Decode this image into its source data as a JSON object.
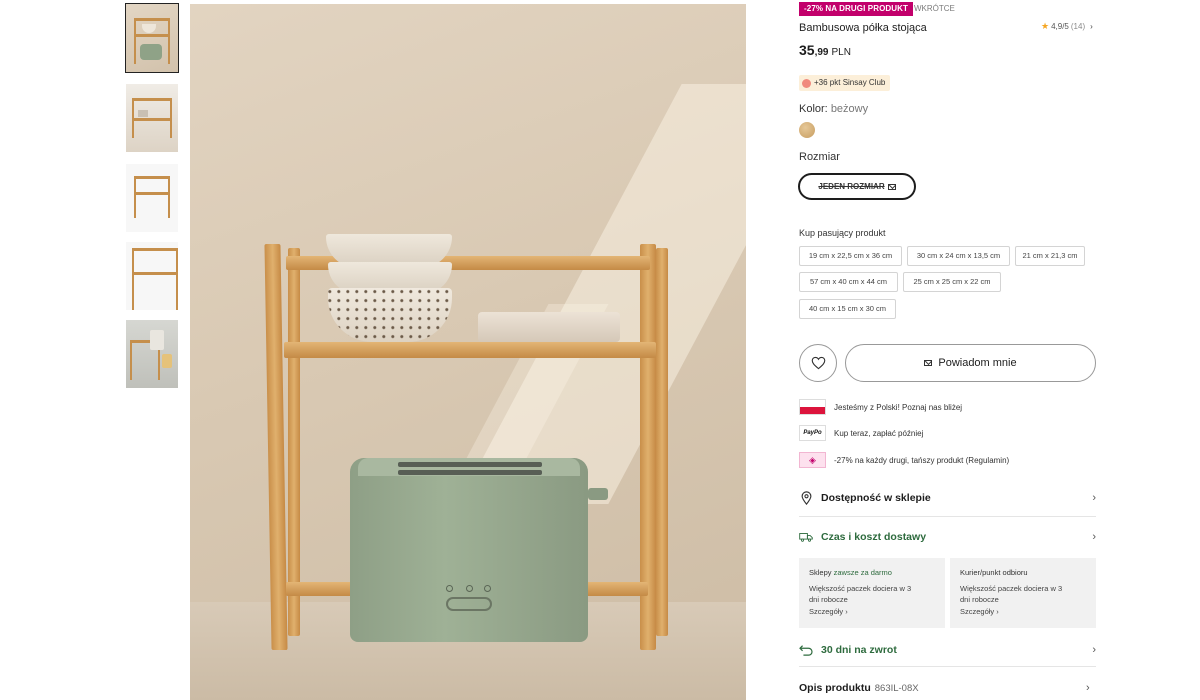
{
  "badges": {
    "promo": "-27% NA DRUGI PRODUKT",
    "soon": "WKRÓTCE"
  },
  "rating": {
    "score": "4,9/5",
    "count": "(14)",
    "chevron": "›"
  },
  "product": {
    "title": "Bambusowa półka stojąca",
    "price_int": "35",
    "price_dec": ",99",
    "currency": "PLN",
    "club": "+36 pkt Sinsay Club"
  },
  "color": {
    "label": "Kolor:",
    "value": "beżowy",
    "swatch": "#d4b07a"
  },
  "size": {
    "label": "Rozmiar",
    "option": "JEDEN ROZMIAR"
  },
  "matching": {
    "title": "Kup pasujący produkt",
    "chips": [
      "19 cm x 22,5 cm x 36 cm",
      "30 cm x 24 cm x 13,5 cm",
      "21 cm x 21,3 cm",
      "57 cm x 40 cm x 44 cm",
      "25 cm x 25 cm x 22 cm",
      "40 cm x 15 cm x 30 cm"
    ]
  },
  "actions": {
    "notify": "Powiadom mnie"
  },
  "info": {
    "polish": "Jesteśmy z Polski! Poznaj nas bliżej",
    "paypo_logo": "PayPo",
    "paypo": "Kup teraz, zapłać później",
    "discount": "-27% na każdy drugi, tańszy produkt (Regulamin)"
  },
  "accordion": {
    "availability": "Dostępność w sklepie",
    "delivery": "Czas i koszt dostawy",
    "returns": "30 dni na zwrot",
    "chevron": "›"
  },
  "delivery_cards": [
    {
      "title": "Sklepy",
      "highlight": "zawsze za darmo",
      "line1": "Większość paczek dociera w 3",
      "line2": "dni robocze",
      "more": "Szczegóły ›"
    },
    {
      "title": "Kurier/punkt odbioru",
      "highlight": "",
      "line1": "Większość paczek dociera w 3",
      "line2": "dni robocze",
      "more": "Szczegóły ›"
    }
  ],
  "description": {
    "label": "Opis produktu",
    "code": "863IL-08X",
    "chevron": "›"
  },
  "colors": {
    "promo": "#c2006b",
    "accent_green": "#2e6b3e"
  }
}
